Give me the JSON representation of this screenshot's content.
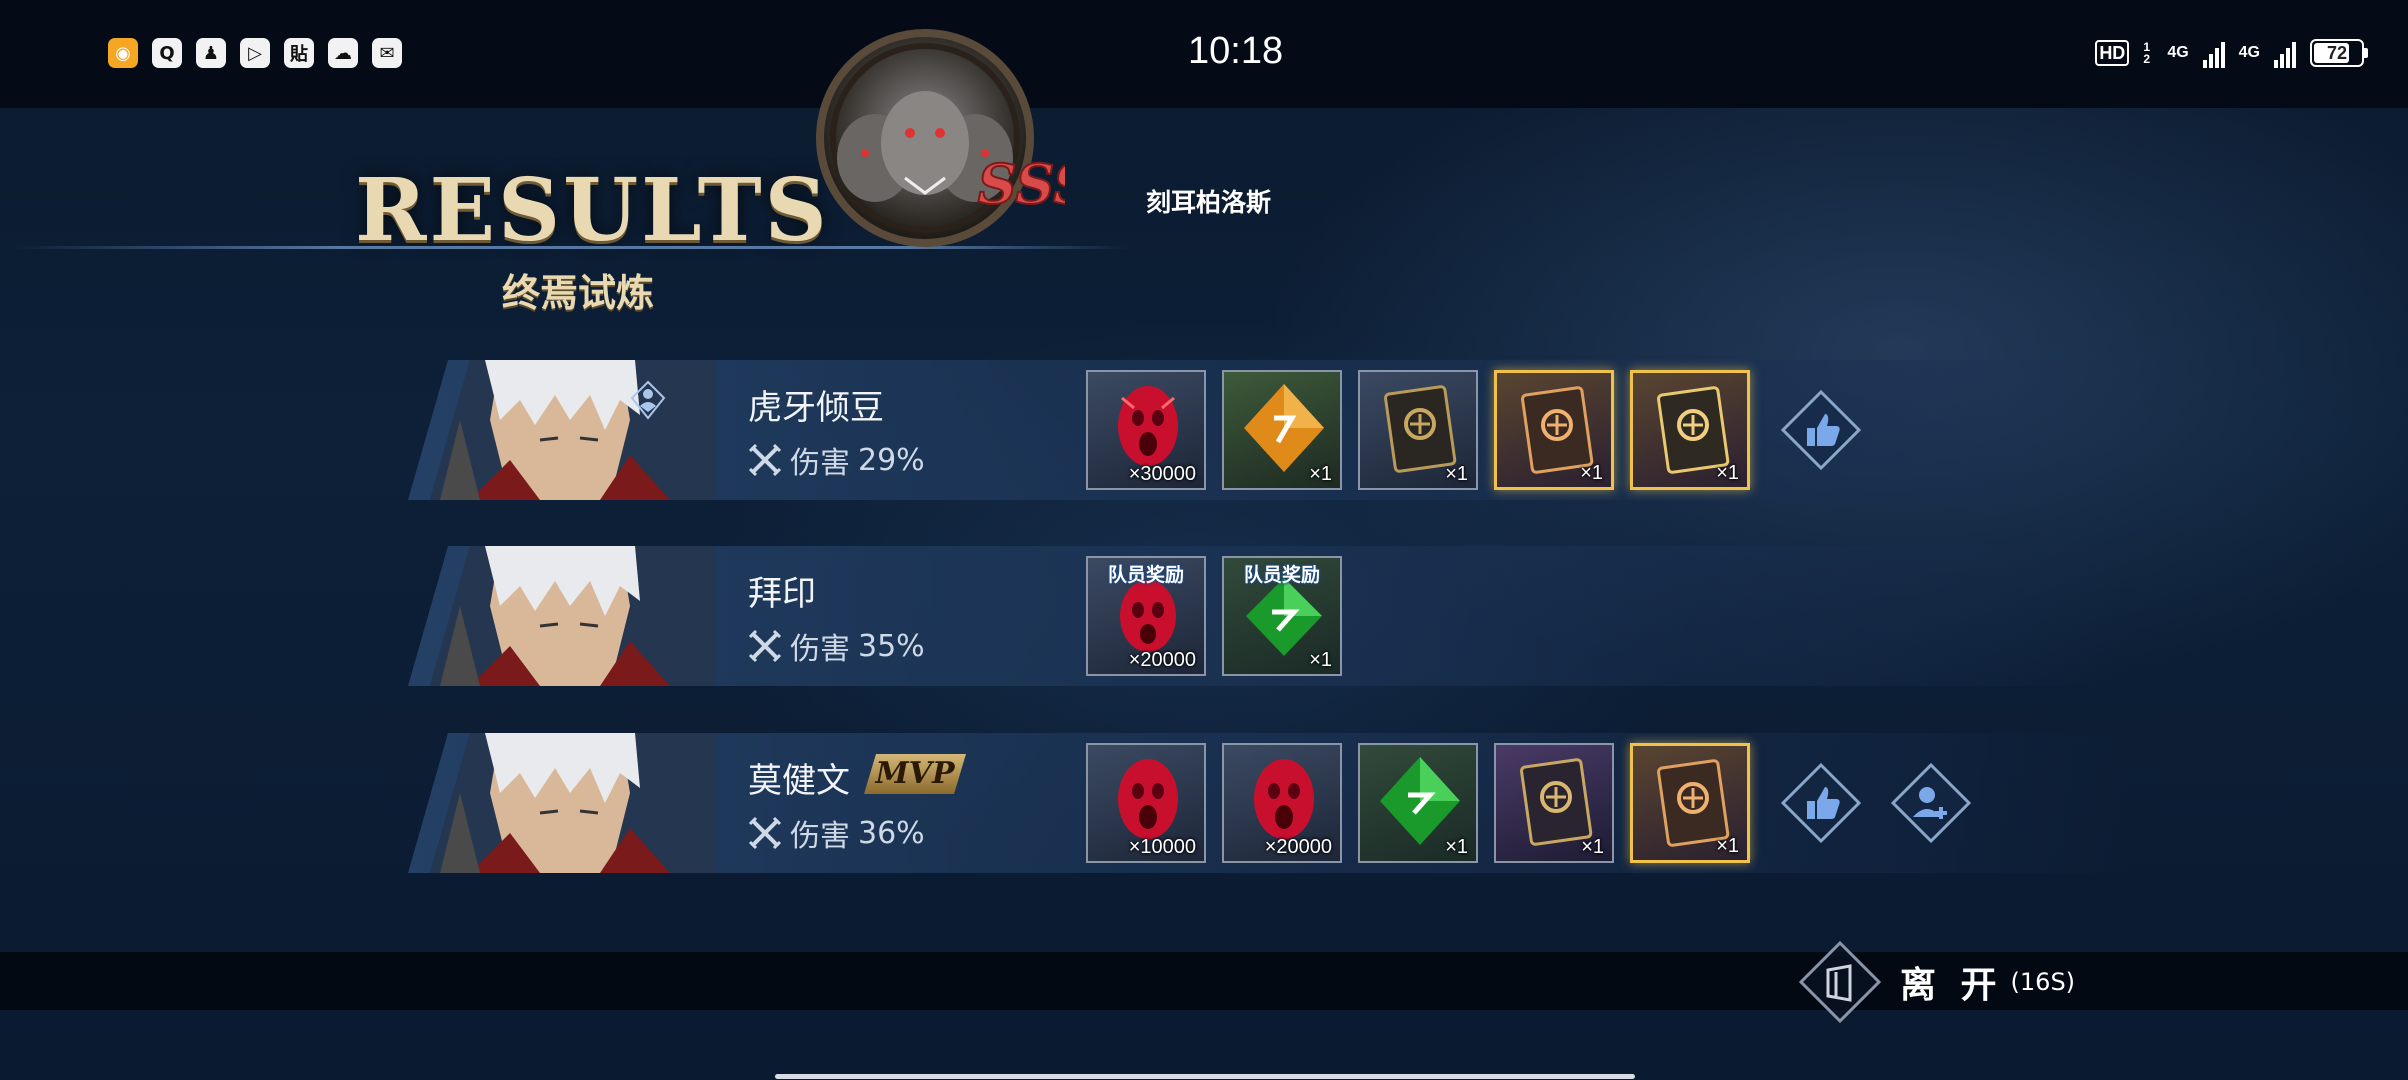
{
  "status_bar": {
    "time": "10:18",
    "apps": [
      "貼"
    ],
    "hd_label": "HD",
    "hd_sub": "1 2",
    "signal_1": "4G",
    "signal_2": "4G",
    "battery": "72"
  },
  "header": {
    "title": "RESULTS",
    "subtitle": "终焉试炼",
    "boss_name": "刻耳柏洛斯",
    "grade": "SSS"
  },
  "players": [
    {
      "name": "虎牙倾豆",
      "damage_label": "伤害",
      "damage": "29%",
      "mvp": false,
      "items": [
        {
          "icon": "red-mask-icon",
          "qty": "×30000"
        },
        {
          "icon": "orange-crystal-icon",
          "qty": "×1"
        },
        {
          "icon": "dark-card-icon",
          "qty": "×1"
        },
        {
          "icon": "gold-card-icon",
          "qty": "×1",
          "highlight": true
        },
        {
          "icon": "gold-card-icon",
          "qty": "×1",
          "highlight": true
        }
      ]
    },
    {
      "name": "拜印",
      "damage_label": "伤害",
      "damage": "35%",
      "mvp": false,
      "items": [
        {
          "icon": "red-mask-icon",
          "qty": "×20000",
          "tag": "队员奖励"
        },
        {
          "icon": "green-crystal-icon",
          "qty": "×1",
          "tag": "队员奖励"
        }
      ]
    },
    {
      "name": "莫健文",
      "damage_label": "伤害",
      "damage": "36%",
      "mvp": true,
      "mvp_label": "MVP",
      "items": [
        {
          "icon": "red-mask-icon",
          "qty": "×10000"
        },
        {
          "icon": "red-mask-icon",
          "qty": "×20000"
        },
        {
          "icon": "green-crystal-icon",
          "qty": "×1"
        },
        {
          "icon": "purple-card-icon",
          "qty": "×1"
        },
        {
          "icon": "gold-card-icon",
          "qty": "×1",
          "highlight": true
        }
      ]
    }
  ],
  "footer": {
    "leave_label": "离 开",
    "countdown": "(16S)"
  }
}
